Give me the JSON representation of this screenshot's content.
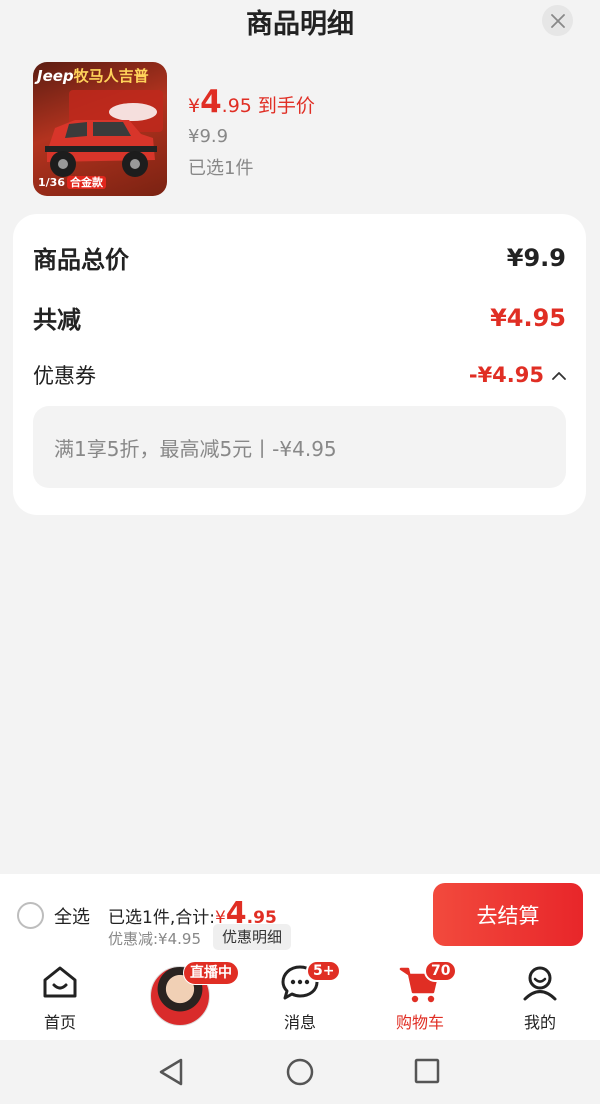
{
  "header": {
    "title": "商品明细"
  },
  "product": {
    "image_brand": "Jeep",
    "image_brand_cn": "牧马人吉普",
    "image_scale": "1/36",
    "image_tag": "合金款",
    "price_yen": "¥",
    "price_int": "4",
    "price_dec": ".95",
    "price_note": "到手价",
    "original_price": "¥9.9",
    "selected_text": "已选1件"
  },
  "summary": {
    "total_label": "商品总价",
    "total_value": "¥9.9",
    "reduce_label": "共减",
    "reduce_value": "¥4.95",
    "coupon_label": "优惠券",
    "coupon_value": "-¥4.95",
    "coupon_detail": "满1享5折，最高减5元丨-¥4.95"
  },
  "checkout": {
    "select_all": "全选",
    "selected_prefix": "已选1件,合计:",
    "sum_yen": "¥",
    "sum_int": "4",
    "sum_dec": ".95",
    "discount_text": "优惠减:¥4.95",
    "detail_button": "优惠明细",
    "checkout_button": "去结算"
  },
  "tabbar": {
    "tabs": [
      {
        "label": "首页",
        "icon": "home-icon"
      },
      {
        "label": "",
        "icon": "live-avatar",
        "badge": "直播中"
      },
      {
        "label": "消息",
        "icon": "message-icon",
        "badge": "5+"
      },
      {
        "label": "购物车",
        "icon": "cart-icon",
        "badge": "70",
        "active": true
      },
      {
        "label": "我的",
        "icon": "profile-icon"
      }
    ]
  },
  "colors": {
    "accent": "#e02e24",
    "background": "#f3f3f3",
    "card": "#ffffff"
  },
  "system_nav": {
    "buttons": [
      "back-icon",
      "home-circle-icon",
      "recents-icon"
    ]
  }
}
